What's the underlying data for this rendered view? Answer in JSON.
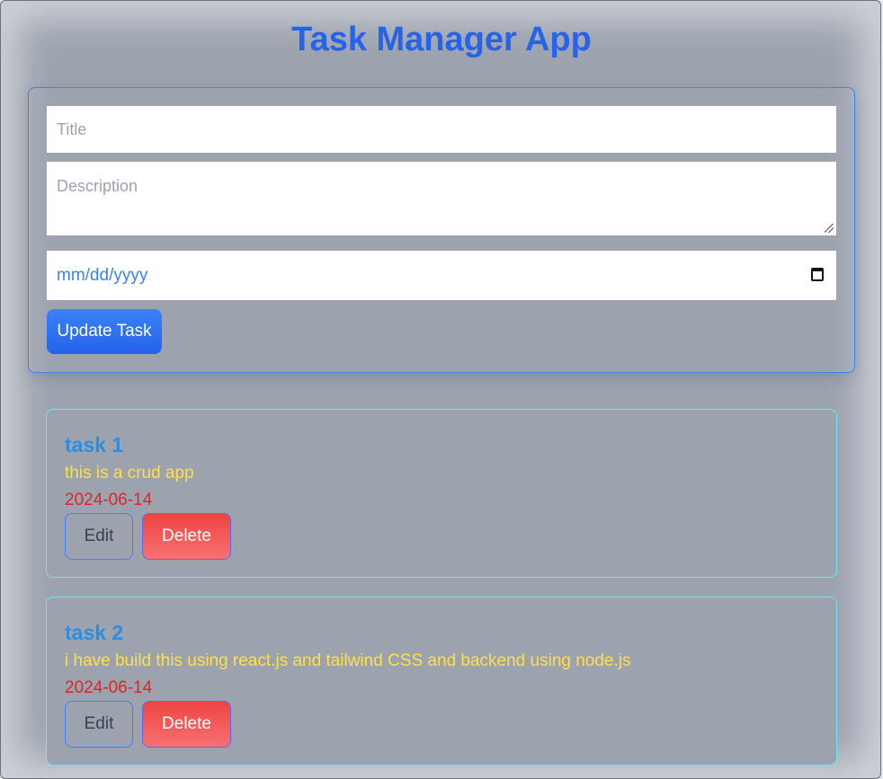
{
  "app": {
    "title": "Task Manager App"
  },
  "form": {
    "title_placeholder": "Title",
    "description_placeholder": "Description",
    "date_placeholder": "mm/dd/yyyy",
    "submit_label": "Update Task"
  },
  "tasks": [
    {
      "title": "task 1",
      "description": "this is a crud app",
      "date": "2024-06-14",
      "edit_label": "Edit",
      "delete_label": "Delete"
    },
    {
      "title": "task 2",
      "description": "i have build this using react.js and tailwind CSS and backend using node.js",
      "date": "2024-06-14",
      "edit_label": "Edit",
      "delete_label": "Delete"
    }
  ],
  "colors": {
    "accent": "#2563eb",
    "task_title": "#2b8ee0",
    "task_description": "#fde047",
    "task_date": "#dc2626",
    "delete": "#ef4444",
    "background": "#9ca3af"
  }
}
